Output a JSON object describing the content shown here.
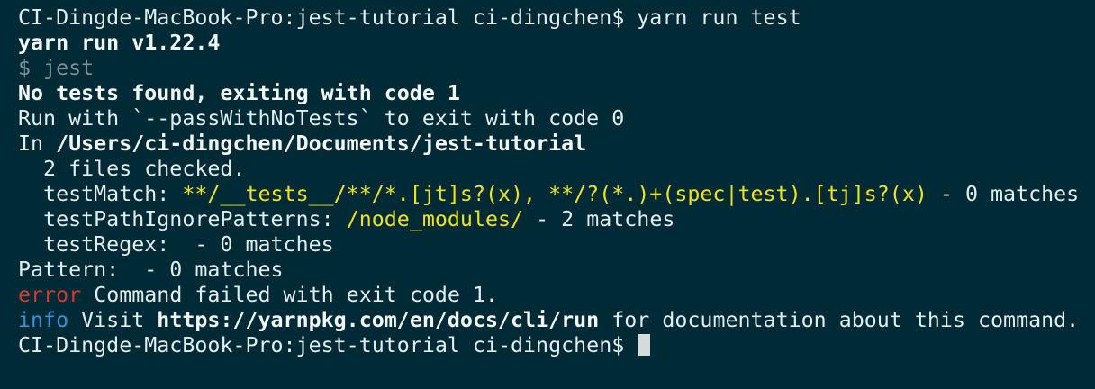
{
  "terminal": {
    "prompt": "CI-Dingde-MacBook-Pro:jest-tutorial ci-dingchen$ ",
    "command": "yarn run test",
    "lines": {
      "yarn_version": "yarn run v1.22.4",
      "jest_cmd": "$ jest",
      "no_tests": "No tests found, exiting with code 1",
      "run_with": "Run with `--passWithNoTests` to exit with code 0",
      "in_prefix": "In ",
      "in_path": "/Users/ci-dingchen/Documents/jest-tutorial",
      "files_checked": "  2 files checked.",
      "test_match_label": "  testMatch: ",
      "test_match_value": "**/__tests__/**/*.[jt]s?(x), **/?(*.)+(spec|test).[tj]s?(x)",
      "test_match_count": " - 0 matches",
      "ignore_label": "  testPathIgnorePatterns: ",
      "ignore_value": "/node_modules/",
      "ignore_count": " - 2 matches",
      "test_regex": "  testRegex:  - 0 matches",
      "pattern": "Pattern:  - 0 matches",
      "error_tag": "error",
      "error_text": " Command failed with exit code 1.",
      "info_tag": "info",
      "info_text_1": " Visit ",
      "info_url": "https://yarnpkg.com/en/docs/cli/run",
      "info_text_2": " for documentation about this command."
    },
    "colors": {
      "background": "#002b36",
      "text": "#e3ecee",
      "highlight": "#f1e21a",
      "error": "#d23b34",
      "info": "#3a92d8",
      "dim": "#7d8f94"
    }
  }
}
